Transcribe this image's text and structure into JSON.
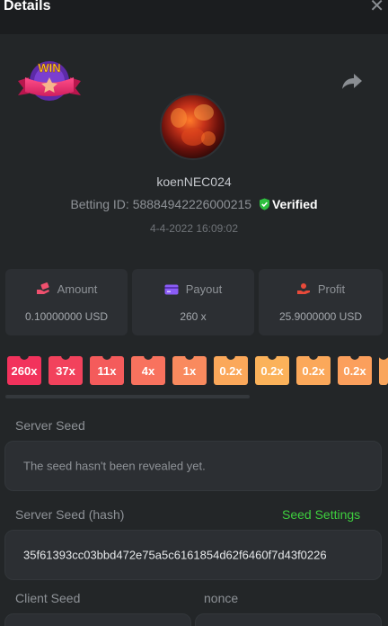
{
  "header": {
    "title": "Details",
    "close_icon": "close-icon"
  },
  "bet": {
    "username": "koenNEC024",
    "betting_id_label": "Betting ID:",
    "betting_id": "58884942226000215",
    "verified_label": "Verified",
    "date": "4-4-2022 16:09:02",
    "win_badge_text": "WIN"
  },
  "stats": [
    {
      "label": "Amount",
      "value": "0.10000000 USD",
      "icon": "hand-coin-icon"
    },
    {
      "label": "Payout",
      "value": "260 x",
      "icon": "card-icon"
    },
    {
      "label": "Profit",
      "value": "25.9000000 USD",
      "icon": "hand-profit-icon"
    }
  ],
  "multipliers": [
    {
      "label": "260x",
      "color": "#f2325c"
    },
    {
      "label": "37x",
      "color": "#f2425c"
    },
    {
      "label": "11x",
      "color": "#f45b5b"
    },
    {
      "label": "4x",
      "color": "#f8725e"
    },
    {
      "label": "1x",
      "color": "#f98a5e"
    },
    {
      "label": "0.2x",
      "color": "#fba85a"
    },
    {
      "label": "0.2x",
      "color": "#fbb25a"
    },
    {
      "label": "0.2x",
      "color": "#fba85a"
    },
    {
      "label": "0.2x",
      "color": "#fb9f5c"
    }
  ],
  "server_seed": {
    "label": "Server Seed",
    "value": "The seed hasn't been revealed yet."
  },
  "server_seed_hash": {
    "label": "Server Seed (hash)",
    "settings_link": "Seed Settings",
    "value": "35f61393cc03bbd472e75a5c6161854d62f6460f7d43f0226"
  },
  "client_seed": {
    "label": "Client Seed"
  },
  "nonce": {
    "label": "nonce"
  },
  "colors": {
    "accent_green": "#3ecf3e",
    "background": "#232628",
    "panel": "#2c2f33"
  }
}
